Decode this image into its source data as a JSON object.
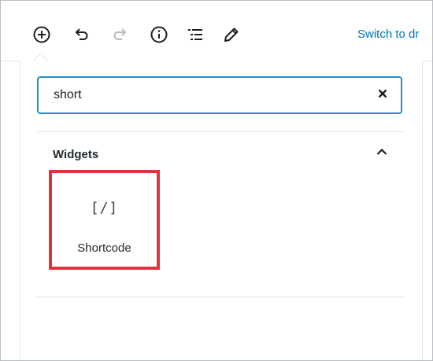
{
  "toolbar": {
    "buttons": [
      {
        "name": "add-block",
        "icon": "plus-circle-icon"
      },
      {
        "name": "undo",
        "icon": "undo-icon"
      },
      {
        "name": "redo",
        "icon": "redo-icon"
      },
      {
        "name": "content-info",
        "icon": "info-icon"
      },
      {
        "name": "block-navigation",
        "icon": "list-view-icon"
      },
      {
        "name": "tools",
        "icon": "pencil-icon"
      }
    ],
    "switch_link": "Switch to dr"
  },
  "inserter": {
    "search": {
      "value": "short",
      "clear_icon": "close-icon"
    },
    "panel": {
      "title": "Widgets",
      "toggle_icon": "chevron-up-icon",
      "items": [
        {
          "label": "Shortcode",
          "icon_text": "[/]",
          "icon": "shortcode-icon"
        }
      ]
    }
  },
  "colors": {
    "accent": "#0073aa",
    "search_border": "#2b8fc7",
    "highlight": "#e0353e",
    "divider": "#e2e4e7",
    "icon": "#40464d",
    "icon_disabled": "#b5b9bd"
  }
}
